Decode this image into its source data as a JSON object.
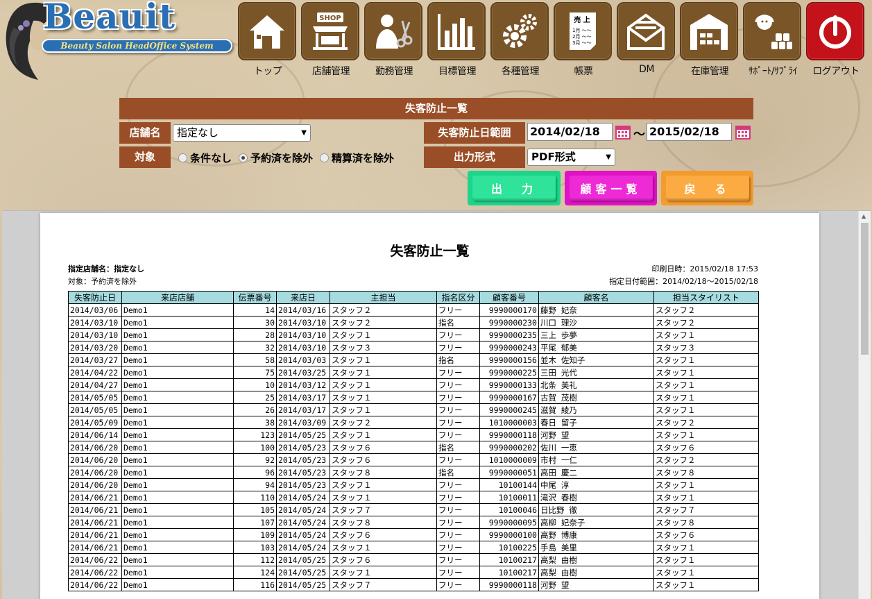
{
  "app": {
    "logo_title": "Beauit",
    "logo_subtitle": "Beauty Salon HeadOffice System"
  },
  "nav": [
    {
      "label": "トップ",
      "icon": "house-icon"
    },
    {
      "label": "店舗管理",
      "icon": "shop-icon"
    },
    {
      "label": "勤務管理",
      "icon": "stylist-scissors-icon"
    },
    {
      "label": "目標管理",
      "icon": "bar-chart-icon"
    },
    {
      "label": "各種管理",
      "icon": "gears-icon"
    },
    {
      "label": "帳票",
      "icon": "sales-document-icon"
    },
    {
      "label": "DM",
      "icon": "envelope-icon"
    },
    {
      "label": "在庫管理",
      "icon": "warehouse-icon"
    },
    {
      "label": "ｻﾎﾟｰﾄ/ｻﾌﾟﾗｲ",
      "icon": "support-operator-icon"
    },
    {
      "label": "ログアウト",
      "icon": "power-icon"
    }
  ],
  "calendar_icon_text": "▦",
  "shop_icon_text": "SHOP",
  "sales_icon": {
    "title": "売 上",
    "lines": [
      "1月 〜〜",
      "2月 〜〜",
      "3月 〜〜"
    ]
  },
  "form": {
    "title": "失客防止一覧",
    "store_label": "店舗名",
    "store_value": "指定なし",
    "period_label": "失客防止日範囲",
    "date_from": "2014/02/18",
    "date_tilde": "～",
    "date_to": "2015/02/18",
    "target_label": "対象",
    "radio_options": [
      {
        "label": "条件なし",
        "checked": false
      },
      {
        "label": "予約済を除外",
        "checked": true
      },
      {
        "label": "精算済を除外",
        "checked": false
      }
    ],
    "output_label": "出力形式",
    "output_value": "PDF形式",
    "buttons": {
      "output": "出　力",
      "customers": "顧客一覧",
      "back": "戻　る"
    },
    "colors": {
      "label_bg": "#9a4e28",
      "output_btn": "#1dd58a",
      "customers_btn": "#e012c6",
      "back_btn": "#f59a2c"
    }
  },
  "report": {
    "title": "失客防止一覧",
    "store_line": "指定店舗名：指定なし",
    "target_line": "対象：予約済を除外",
    "printed_line": "印刷日時：2015/02/18 17:53",
    "range_line": "指定日付範囲：2014/02/18～2015/02/18",
    "columns": [
      "失客防止日",
      "来店店舗",
      "伝票番号",
      "来店日",
      "主担当",
      "指名区分",
      "顧客番号",
      "顧客名",
      "担当スタイリスト"
    ],
    "rows": [
      [
        "2014/03/06",
        "Demo1",
        "14",
        "2014/03/16",
        "スタッフ２",
        "フリー",
        "9990000170",
        "藤野 妃奈",
        "スタッフ２"
      ],
      [
        "2014/03/10",
        "Demo1",
        "30",
        "2014/03/10",
        "スタッフ２",
        "指名",
        "9990000230",
        "川口 理沙",
        "スタッフ２"
      ],
      [
        "2014/03/10",
        "Demo1",
        "28",
        "2014/03/10",
        "スタッフ１",
        "フリー",
        "9990000235",
        "三上 歩夢",
        "スタッフ１"
      ],
      [
        "2014/03/20",
        "Demo1",
        "32",
        "2014/03/10",
        "スタッフ３",
        "フリー",
        "9990000243",
        "平尾 郁美",
        "スタッフ３"
      ],
      [
        "2014/03/27",
        "Demo1",
        "58",
        "2014/03/03",
        "スタッフ１",
        "指名",
        "9990000156",
        "並木 佐知子",
        "スタッフ１"
      ],
      [
        "2014/04/22",
        "Demo1",
        "75",
        "2014/03/25",
        "スタッフ１",
        "フリー",
        "9990000225",
        "三田 光代",
        "スタッフ１"
      ],
      [
        "2014/04/27",
        "Demo1",
        "10",
        "2014/03/12",
        "スタッフ１",
        "フリー",
        "9990000133",
        "北条 美礼",
        "スタッフ１"
      ],
      [
        "2014/05/05",
        "Demo1",
        "25",
        "2014/03/17",
        "スタッフ１",
        "フリー",
        "9990000167",
        "古賀 茂樹",
        "スタッフ１"
      ],
      [
        "2014/05/05",
        "Demo1",
        "26",
        "2014/03/17",
        "スタッフ１",
        "フリー",
        "9990000245",
        "滋賀 綾乃",
        "スタッフ１"
      ],
      [
        "2014/05/09",
        "Demo1",
        "38",
        "2014/03/09",
        "スタッフ２",
        "フリー",
        "1010000003",
        "春日 留子",
        "スタッフ２"
      ],
      [
        "2014/06/14",
        "Demo1",
        "123",
        "2014/05/25",
        "スタッフ１",
        "フリー",
        "9990000118",
        "河野 望",
        "スタッフ１"
      ],
      [
        "2014/06/20",
        "Demo1",
        "100",
        "2014/05/23",
        "スタッフ６",
        "指名",
        "9990000202",
        "佐川 一恵",
        "スタッフ６"
      ],
      [
        "2014/06/20",
        "Demo1",
        "92",
        "2014/05/23",
        "スタッフ６",
        "フリー",
        "1010000009",
        "市村 一仁",
        "スタッフ２"
      ],
      [
        "2014/06/20",
        "Demo1",
        "96",
        "2014/05/23",
        "スタッフ８",
        "指名",
        "9990000051",
        "高田 慶二",
        "スタッフ８"
      ],
      [
        "2014/06/20",
        "Demo1",
        "94",
        "2014/05/23",
        "スタッフ１",
        "フリー",
        "10100144",
        "中尾 淳",
        "スタッフ１"
      ],
      [
        "2014/06/21",
        "Demo1",
        "110",
        "2014/05/24",
        "スタッフ１",
        "フリー",
        "10100011",
        "滝沢 春樹",
        "スタッフ１"
      ],
      [
        "2014/06/21",
        "Demo1",
        "105",
        "2014/05/24",
        "スタッフ７",
        "フリー",
        "10100046",
        "日比野 徹",
        "スタッフ７"
      ],
      [
        "2014/06/21",
        "Demo1",
        "107",
        "2014/05/24",
        "スタッフ８",
        "フリー",
        "9990000095",
        "高柳 妃奈子",
        "スタッフ８"
      ],
      [
        "2014/06/21",
        "Demo1",
        "109",
        "2014/05/24",
        "スタッフ６",
        "フリー",
        "9990000100",
        "高野 博康",
        "スタッフ６"
      ],
      [
        "2014/06/21",
        "Demo1",
        "103",
        "2014/05/24",
        "スタッフ１",
        "フリー",
        "10100225",
        "手島 美里",
        "スタッフ１"
      ],
      [
        "2014/06/22",
        "Demo1",
        "112",
        "2014/05/25",
        "スタッフ６",
        "フリー",
        "10100217",
        "高梨 由樹",
        "スタッフ１"
      ],
      [
        "2014/06/22",
        "Demo1",
        "124",
        "2014/05/25",
        "スタッフ１",
        "フリー",
        "10100217",
        "高梨 由樹",
        "スタッフ１"
      ],
      [
        "2014/06/22",
        "Demo1",
        "116",
        "2014/05/25",
        "スタッフ７",
        "フリー",
        "9990000118",
        "河野 望",
        "スタッフ１"
      ]
    ]
  }
}
